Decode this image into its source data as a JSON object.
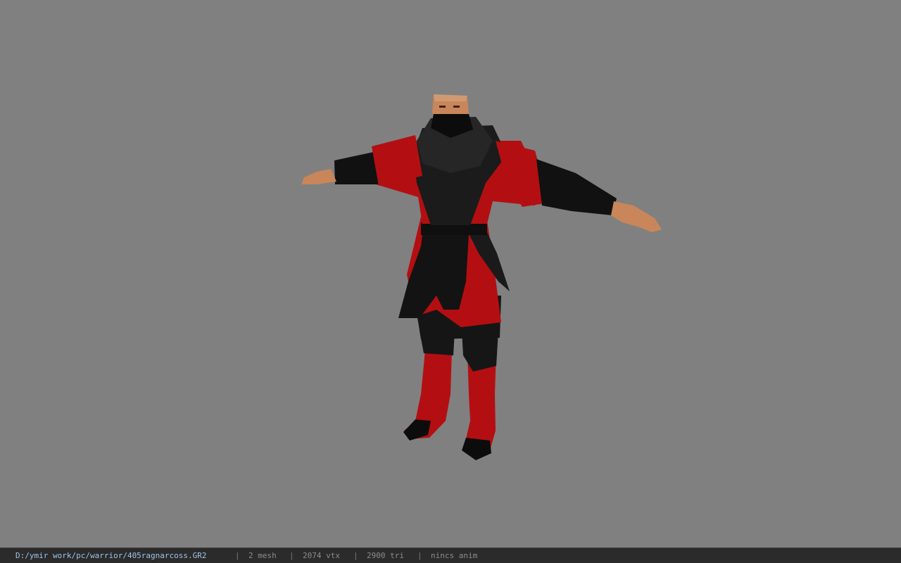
{
  "viewer": {
    "background_color": "#808080",
    "model": {
      "description_icon": "character-model",
      "primary_color": "#b30f12",
      "secondary_color": "#101010",
      "skin_color": "#c9865a"
    }
  },
  "status_bar": {
    "file_path": "D:/ymir work/pc/warrior/405ragnarcoss.GR2",
    "separator": "|",
    "mesh_count": "2 mesh",
    "vertex_count": "2074 vtx",
    "triangle_count": "2900 tri",
    "anim_label": "nincs anim"
  }
}
